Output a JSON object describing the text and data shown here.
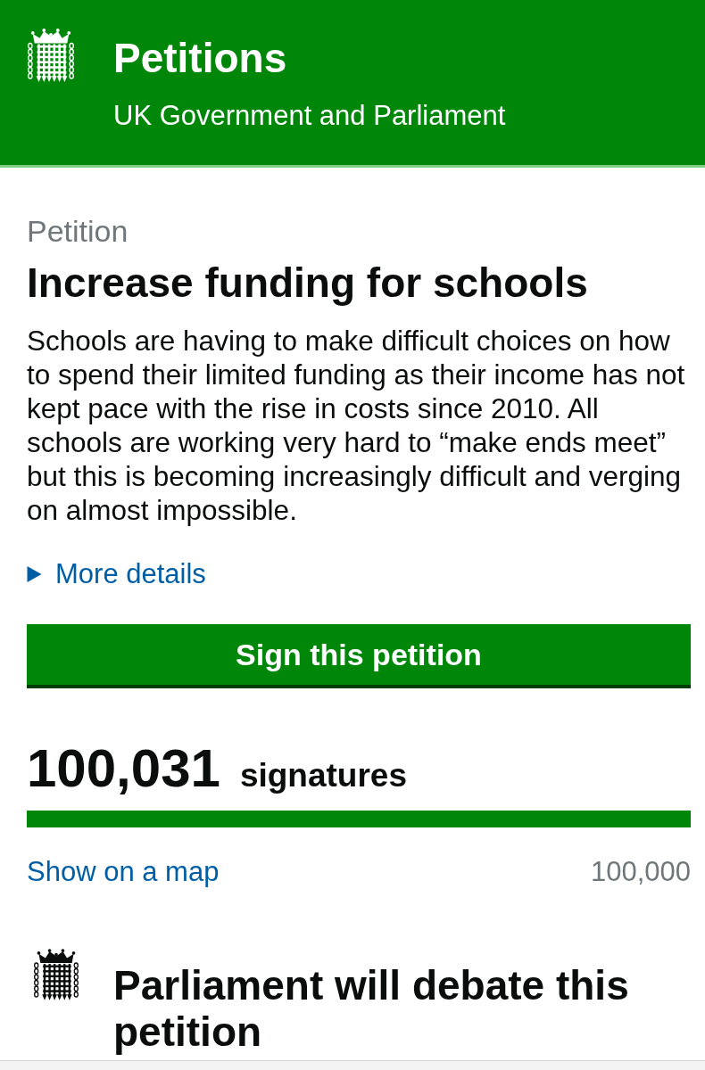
{
  "header": {
    "title": "Petitions",
    "subtitle": "UK Government and Parliament"
  },
  "petition": {
    "label": "Petition",
    "title": "Increase funding for schools",
    "description": "Schools are having to make difficult choices on how to spend their limited funding as their income has not kept pace with the rise in costs since 2010. All schools are working very hard to “make ends meet” but this is becoming increasingly difficult and verging on almost impossible.",
    "details_toggle": {
      "label": "More details",
      "expanded": false
    }
  },
  "sign_button": "Sign this petition",
  "signatures": {
    "count": "100,031",
    "unit": "signatures",
    "level": 1,
    "map_link": "Show on a map",
    "target": "100,000"
  },
  "debate": {
    "title": "Parliament will debate this petition"
  }
}
